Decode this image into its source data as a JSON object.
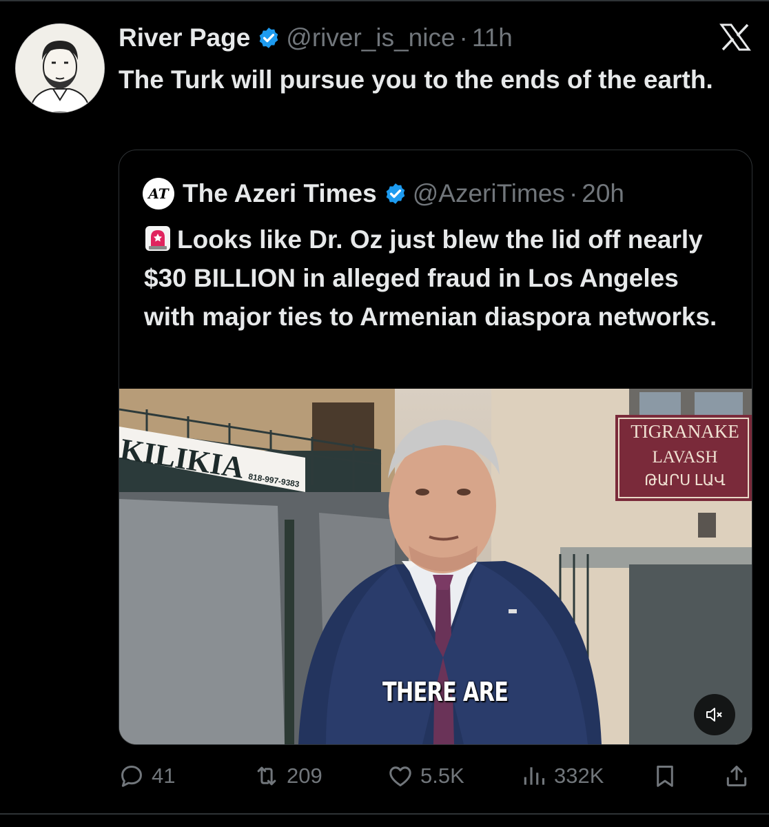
{
  "tweet": {
    "author_name": "River Page",
    "author_handle": "@river_is_nice",
    "separator": "·",
    "time": "11h",
    "text": "The Turk will pursue you to the ends of the earth."
  },
  "quoted_tweet": {
    "author_name": "The Azeri Times",
    "author_handle": "@AzeriTimes",
    "separator": "·",
    "time": "20h",
    "logo_text": "AT",
    "text": "Looks like Dr. Oz just blew the lid off nearly $30 BILLION in alleged fraud in Los Angeles with major ties to Armenian diaspora networks.",
    "emoji": "rotating-light-icon",
    "video": {
      "caption": "THERE ARE",
      "sign_left": "KILIKIA",
      "sign_phone": "818-997-9383",
      "sign_right_line1": "TIGRANAKE",
      "sign_right_line2": "LAVASH",
      "sign_right_line3": "ԹԱՐՍ ԼԱՎ",
      "muted": true
    }
  },
  "actions": {
    "replies": "41",
    "reposts": "209",
    "likes": "5.5K",
    "views": "332K"
  },
  "colors": {
    "background": "#000000",
    "text": "#e7e9ea",
    "muted_text": "#71767b",
    "verified_blue": "#1d9bf0",
    "border": "#2f3336"
  },
  "icons": [
    "x-logo-icon",
    "verified-badge-icon",
    "reply-icon",
    "repost-icon",
    "like-icon",
    "views-icon",
    "bookmark-icon",
    "share-icon",
    "mute-icon"
  ]
}
